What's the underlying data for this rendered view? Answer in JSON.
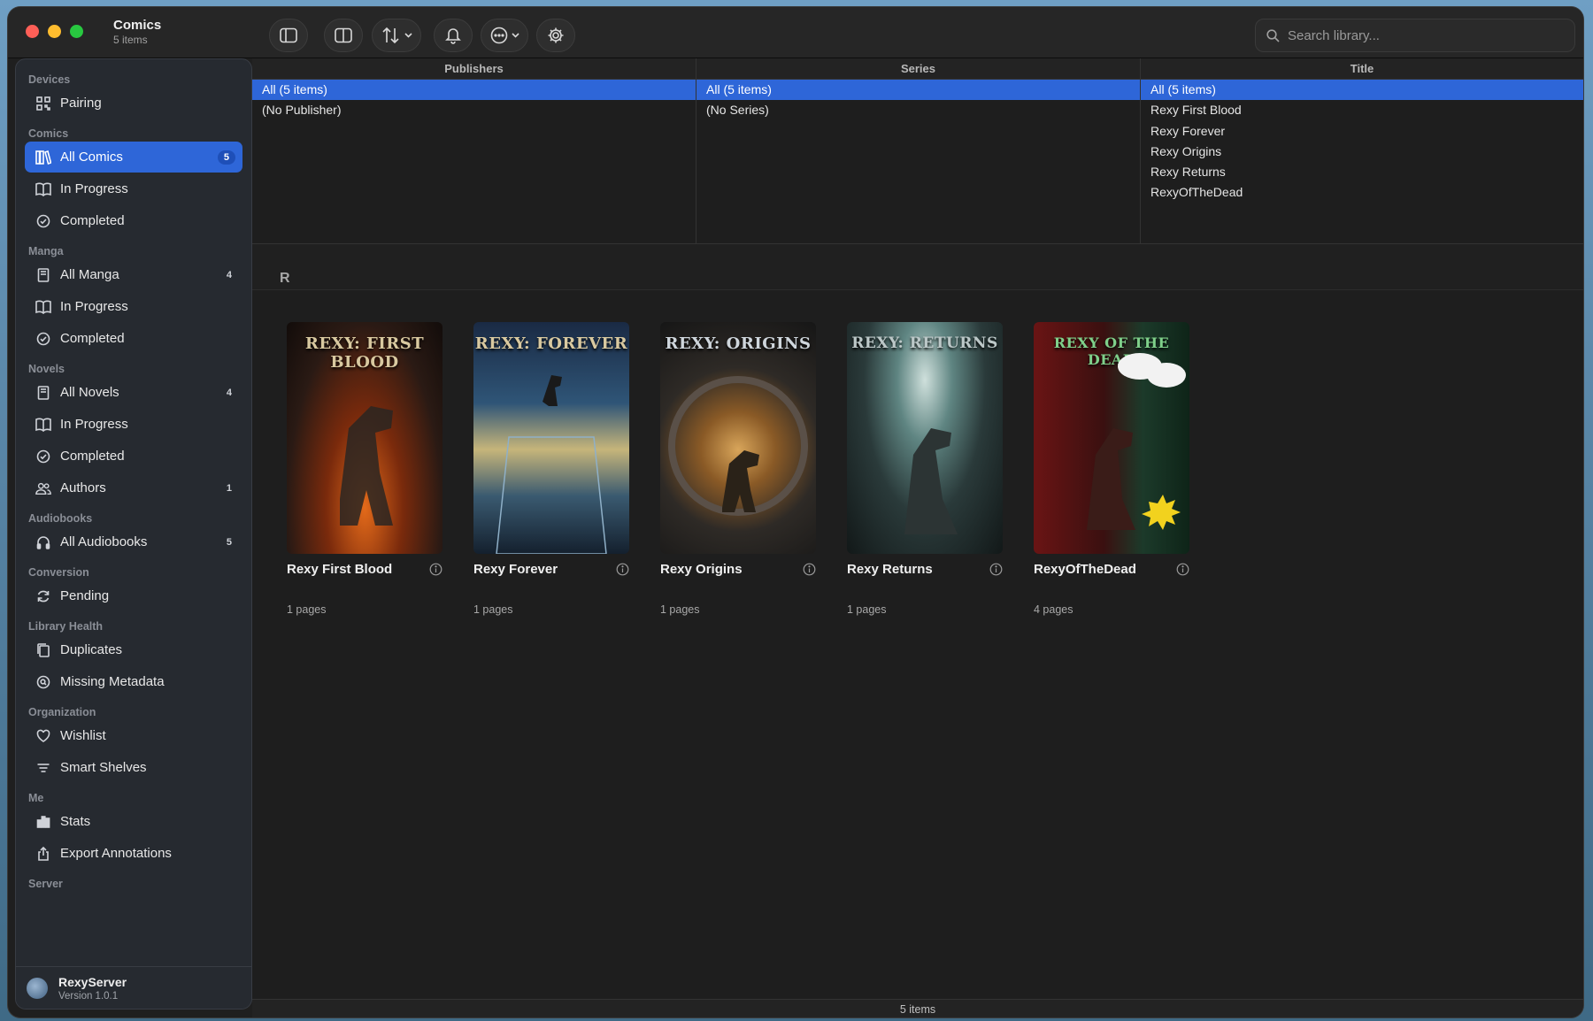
{
  "window": {
    "title": "Comics",
    "subtitle": "5 items"
  },
  "toolbar": {
    "buttons": [
      "sidebar-toggle-icon",
      "columns-icon",
      "sort-icon",
      "bell-icon",
      "more-icon",
      "gear-icon"
    ],
    "search_placeholder": "Search library..."
  },
  "sidebar": {
    "sections": {
      "devices": "Devices",
      "comics": "Comics",
      "manga": "Manga",
      "novels": "Novels",
      "audiobooks": "Audiobooks",
      "conversion": "Conversion",
      "library_health": "Library Health",
      "organization": "Organization",
      "me": "Me",
      "server": "Server"
    },
    "items": {
      "pairing": "Pairing",
      "all_comics": "All Comics",
      "all_comics_count": "5",
      "comics_in_progress": "In Progress",
      "comics_completed": "Completed",
      "all_manga": "All Manga",
      "all_manga_count": "4",
      "manga_in_progress": "In Progress",
      "manga_completed": "Completed",
      "all_novels": "All Novels",
      "all_novels_count": "4",
      "novels_in_progress": "In Progress",
      "novels_completed": "Completed",
      "authors": "Authors",
      "authors_count": "1",
      "all_audiobooks": "All Audiobooks",
      "all_audiobooks_count": "5",
      "pending": "Pending",
      "duplicates": "Duplicates",
      "missing_metadata": "Missing Metadata",
      "wishlist": "Wishlist",
      "smart_shelves": "Smart Shelves",
      "stats": "Stats",
      "export_annotations": "Export Annotations"
    },
    "footer": {
      "server_name": "RexyServer",
      "version": "Version 1.0.1"
    }
  },
  "browser": {
    "publishers": {
      "header": "Publishers",
      "rows": [
        "All (5 items)",
        "(No Publisher)"
      ]
    },
    "series": {
      "header": "Series",
      "rows": [
        "All (5 items)",
        "(No Series)"
      ]
    },
    "title": {
      "header": "Title",
      "rows": [
        "All (5 items)",
        "Rexy First Blood",
        "Rexy Forever",
        "Rexy Origins",
        "Rexy Returns",
        "RexyOfTheDead"
      ]
    }
  },
  "grid": {
    "section_letter": "R",
    "items": [
      {
        "title": "Rexy First Blood",
        "pages": "1 pages",
        "cover_text": "REXY: FIRST BLOOD"
      },
      {
        "title": "Rexy Forever",
        "pages": "1 pages",
        "cover_text": "REXY: FOREVER"
      },
      {
        "title": "Rexy Origins",
        "pages": "1 pages",
        "cover_text": "REXY: ORIGINS"
      },
      {
        "title": "Rexy Returns",
        "pages": "1 pages",
        "cover_text": "REXY: RETURNS"
      },
      {
        "title": "RexyOfTheDead",
        "pages": "4 pages",
        "cover_text": "REXY OF THE DEAD"
      }
    ]
  },
  "status": {
    "count": "5 items"
  },
  "colors": {
    "accent": "#2e66d8",
    "background": "#1e1e1e",
    "sidebar": "#262a30"
  }
}
